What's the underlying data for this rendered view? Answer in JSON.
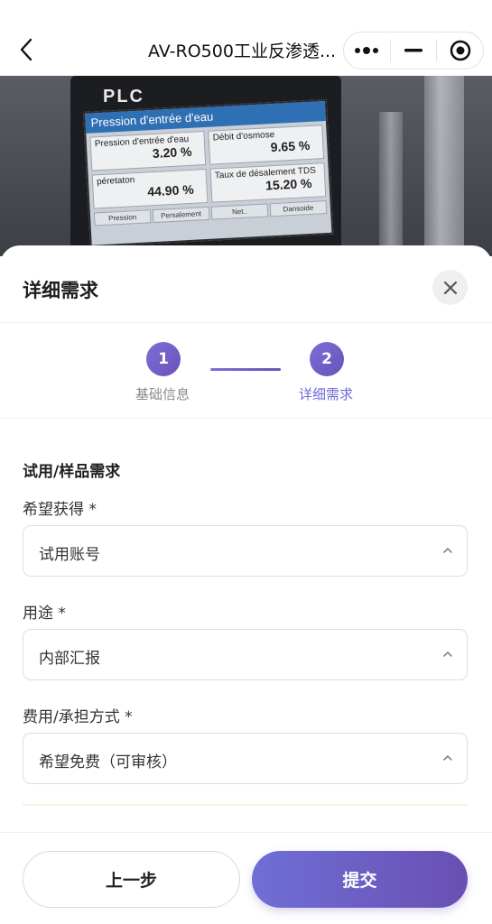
{
  "navbar": {
    "title": "AV-RO500工业反渗透...",
    "back_icon": "chevron-left-icon",
    "more_icon": "more-dots-icon",
    "minimize_icon": "minus-icon",
    "close_icon": "target-circle-icon"
  },
  "hero": {
    "brand": "PLC",
    "screen_title": "Pression d'entrée d'eau",
    "cells": [
      {
        "label": "Pression d'entrée d'eau",
        "value": "3.20 %"
      },
      {
        "label": "Débit d'osmose",
        "value": "9.65 %"
      },
      {
        "label": "péretaton",
        "value": "44.90 %"
      },
      {
        "label": "Taux de désalement TDS",
        "value": "15.20 %"
      }
    ],
    "footer_tabs": [
      "Pression",
      "Persalement",
      "Net..",
      "Dansoide"
    ]
  },
  "sheet": {
    "title": "详细需求",
    "close_icon": "close-icon"
  },
  "stepper": {
    "steps": [
      {
        "number": "1",
        "label": "基础信息",
        "active": false
      },
      {
        "number": "2",
        "label": "详细需求",
        "active": true
      }
    ],
    "accent": "#6a52b8",
    "active_label_color": "#6b6bd6",
    "inactive_label_color": "#8a8a8a"
  },
  "form": {
    "section_title": "试用/样品需求",
    "fields": [
      {
        "label": "希望获得 *",
        "value": "试用账号"
      },
      {
        "label": "用途 *",
        "value": "内部汇报"
      },
      {
        "label": "费用/承担方式 *",
        "value": "希望免费（可审核）"
      }
    ],
    "caret_icon": "chevron-up-icon"
  },
  "footer": {
    "prev_label": "上一步",
    "submit_label": "提交"
  }
}
